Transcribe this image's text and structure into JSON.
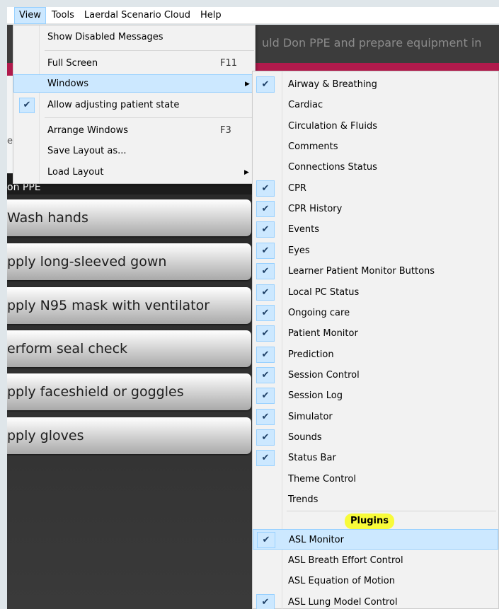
{
  "menubar": {
    "items": [
      "View",
      "Tools",
      "Laerdal Scenario Cloud",
      "Help"
    ]
  },
  "background": {
    "banner_text": "uld Don PPE and prepare equipment in",
    "fragment_text": "e",
    "section_label": "on PPE",
    "steps": [
      "Wash hands",
      "pply long-sleeved gown",
      "pply N95 mask with ventilator",
      "erform seal check",
      "pply faceshield or goggles",
      "pply gloves"
    ]
  },
  "view_menu": {
    "items": [
      {
        "label": "Show Disabled Messages",
        "shortcut": "",
        "checked": false,
        "submenu": false
      },
      {
        "label": "Full Screen",
        "shortcut": "F11",
        "checked": false,
        "submenu": false
      },
      {
        "label": "Windows",
        "shortcut": "",
        "checked": false,
        "submenu": true
      },
      {
        "label": "Allow adjusting patient state",
        "shortcut": "",
        "checked": true,
        "submenu": false
      },
      {
        "label": "Arrange Windows",
        "shortcut": "F3",
        "checked": false,
        "submenu": false
      },
      {
        "label": "Save Layout as...",
        "shortcut": "",
        "checked": false,
        "submenu": false
      },
      {
        "label": "Load Layout",
        "shortcut": "",
        "checked": false,
        "submenu": true
      }
    ]
  },
  "windows_menu": {
    "items": [
      {
        "label": "Airway & Breathing",
        "checked": true
      },
      {
        "label": "Cardiac",
        "checked": false
      },
      {
        "label": "Circulation & Fluids",
        "checked": false
      },
      {
        "label": "Comments",
        "checked": false
      },
      {
        "label": "Connections Status",
        "checked": false
      },
      {
        "label": "CPR",
        "checked": true
      },
      {
        "label": "CPR History",
        "checked": true
      },
      {
        "label": "Events",
        "checked": true
      },
      {
        "label": "Eyes",
        "checked": true
      },
      {
        "label": "Learner Patient Monitor Buttons",
        "checked": true
      },
      {
        "label": "Local PC Status",
        "checked": true
      },
      {
        "label": "Ongoing care",
        "checked": true
      },
      {
        "label": "Patient Monitor",
        "checked": true
      },
      {
        "label": "Prediction",
        "checked": true
      },
      {
        "label": "Session Control",
        "checked": true
      },
      {
        "label": "Session Log",
        "checked": true
      },
      {
        "label": "Simulator",
        "checked": true
      },
      {
        "label": "Sounds",
        "checked": true
      },
      {
        "label": "Status Bar",
        "checked": true
      },
      {
        "label": "Theme Control",
        "checked": false
      },
      {
        "label": "Trends",
        "checked": false
      }
    ],
    "plugins_header": "Plugins",
    "plugin_items": [
      {
        "label": "ASL  Monitor",
        "checked": true
      },
      {
        "label": "ASL Breath Effort Control",
        "checked": false
      },
      {
        "label": "ASL Equation of Motion",
        "checked": false
      },
      {
        "label": "ASL Lung Model Control",
        "checked": true
      }
    ]
  },
  "glyphs": {
    "check": "✔",
    "arrow": "▶"
  }
}
